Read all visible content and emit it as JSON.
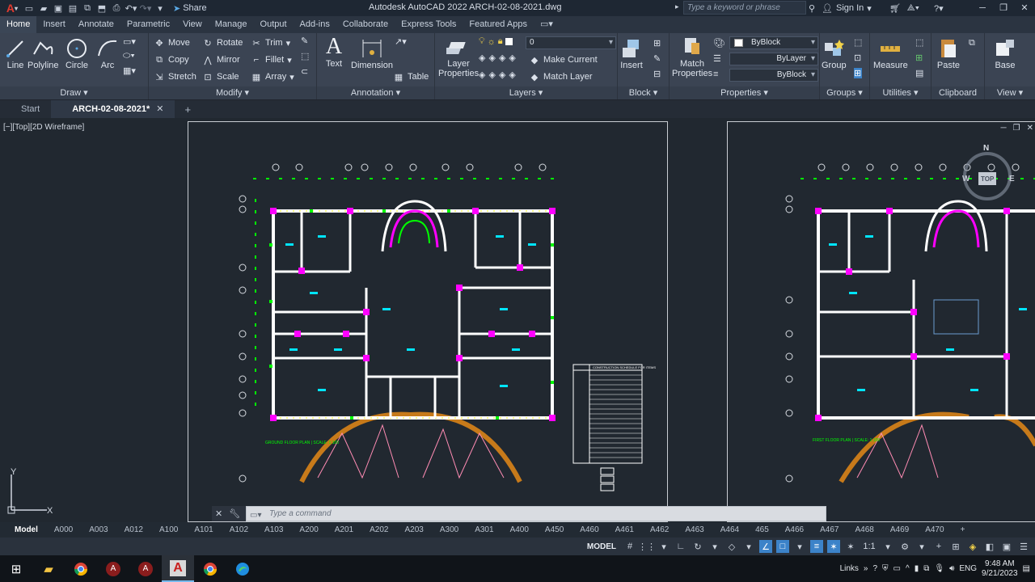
{
  "app": {
    "title": "Autodesk AutoCAD 2022    ARCH-02-08-2021.dwg",
    "share_label": "Share",
    "search_placeholder": "Type a keyword or phrase",
    "sign_in": "Sign In"
  },
  "ribbon_tabs": [
    "Home",
    "Insert",
    "Annotate",
    "Parametric",
    "View",
    "Manage",
    "Output",
    "Add-ins",
    "Collaborate",
    "Express Tools",
    "Featured Apps"
  ],
  "ribbon": {
    "draw": {
      "label": "Draw",
      "line": "Line",
      "polyline": "Polyline",
      "circle": "Circle",
      "arc": "Arc"
    },
    "modify": {
      "label": "Modify",
      "move": "Move",
      "rotate": "Rotate",
      "trim": "Trim",
      "copy": "Copy",
      "mirror": "Mirror",
      "fillet": "Fillet",
      "stretch": "Stretch",
      "scale": "Scale",
      "array": "Array"
    },
    "annotation": {
      "label": "Annotation",
      "text": "Text",
      "dimension": "Dimension",
      "table": "Table"
    },
    "layers": {
      "label": "Layers",
      "layer_properties": "Layer Properties",
      "current_layer": "0",
      "make_current": "Make Current",
      "match_layer": "Match Layer"
    },
    "block": {
      "label": "Block",
      "insert": "Insert"
    },
    "properties": {
      "label": "Properties",
      "match": "Match Properties",
      "color": "ByBlock",
      "linetype": "ByLayer",
      "lineweight": "ByBlock"
    },
    "groups": {
      "label": "Groups",
      "group": "Group"
    },
    "utilities": {
      "label": "Utilities",
      "measure": "Measure"
    },
    "clipboard": {
      "label": "Clipboard",
      "paste": "Paste"
    },
    "view": {
      "label": "View",
      "base": "Base"
    }
  },
  "doc_tabs": {
    "start": "Start",
    "active": "ARCH-02-08-2021*"
  },
  "viewport_label": "[−][Top][2D Wireframe]",
  "viewcube": {
    "n": "N",
    "top": "TOP",
    "w": "W",
    "e": "E"
  },
  "drawing": {
    "ground_caption": "GROUND FLOOR PLAN | SCALE: 1:100",
    "first_caption": "FIRST FLOOR PLAN | SCALE: 1:100",
    "title_block_caption": "CONSTRUCTION SCHEDULE FOR ITEMS"
  },
  "command": {
    "placeholder": "Type a command"
  },
  "layout_tabs": [
    "Model",
    "A000",
    "A003",
    "A012",
    "A100",
    "A101",
    "A102",
    "A103",
    "A200",
    "A201",
    "A202",
    "A203",
    "A300",
    "A301",
    "A400",
    "A450",
    "A460",
    "A461",
    "A462",
    "A463",
    "A464",
    "465",
    "A466",
    "A467",
    "A468",
    "A469",
    "A470"
  ],
  "status": {
    "model": "MODEL",
    "scale": "1:1"
  },
  "taskbar": {
    "links": "Links",
    "lang": "ENG",
    "time": "9:48 AM",
    "date": "9/21/2023"
  },
  "colors": {
    "wall": "#ffffff",
    "column": "#ff00ff",
    "dimension": "#00ff00",
    "text": "#00e5ff",
    "stair": "#ff8cb4",
    "arch": "#c77a1a"
  }
}
